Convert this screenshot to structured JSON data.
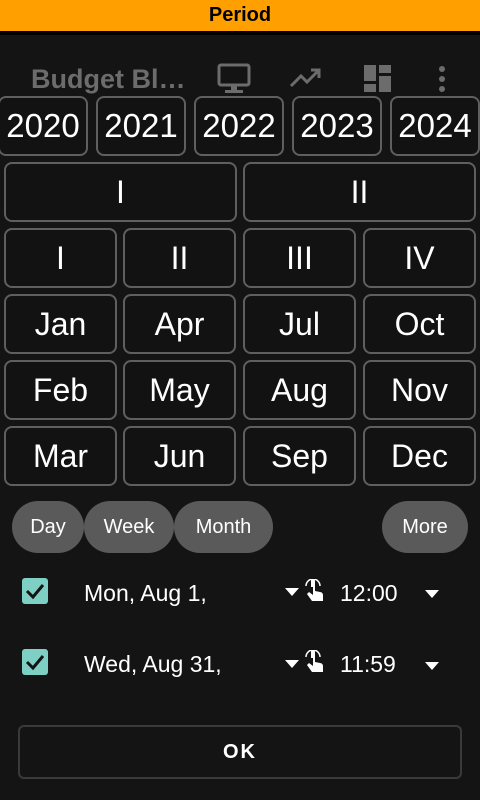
{
  "dialog": {
    "title": "Period"
  },
  "background": {
    "app_title": "Budget Bl…"
  },
  "years": [
    "2020",
    "2021",
    "2022",
    "2023",
    "2024"
  ],
  "halves": [
    "I",
    "II"
  ],
  "quarters": [
    "I",
    "II",
    "III",
    "IV"
  ],
  "months": {
    "row1": [
      "Jan",
      "Apr",
      "Jul",
      "Oct"
    ],
    "row2": [
      "Feb",
      "May",
      "Aug",
      "Nov"
    ],
    "row3": [
      "Mar",
      "Jun",
      "Sep",
      "Dec"
    ]
  },
  "chips": {
    "day": "Day",
    "week": "Week",
    "month": "Month",
    "more": "More"
  },
  "start": {
    "checked": true,
    "date": "Mon, Aug 1,",
    "time": "12:00"
  },
  "end": {
    "checked": true,
    "date": "Wed, Aug 31,",
    "time": "11:59"
  },
  "ok_label": "OK",
  "colors": {
    "titlebar": "#ffa000",
    "checkbox": "#7fd0c4",
    "chip": "#5a5a5a",
    "background": "#141414"
  }
}
